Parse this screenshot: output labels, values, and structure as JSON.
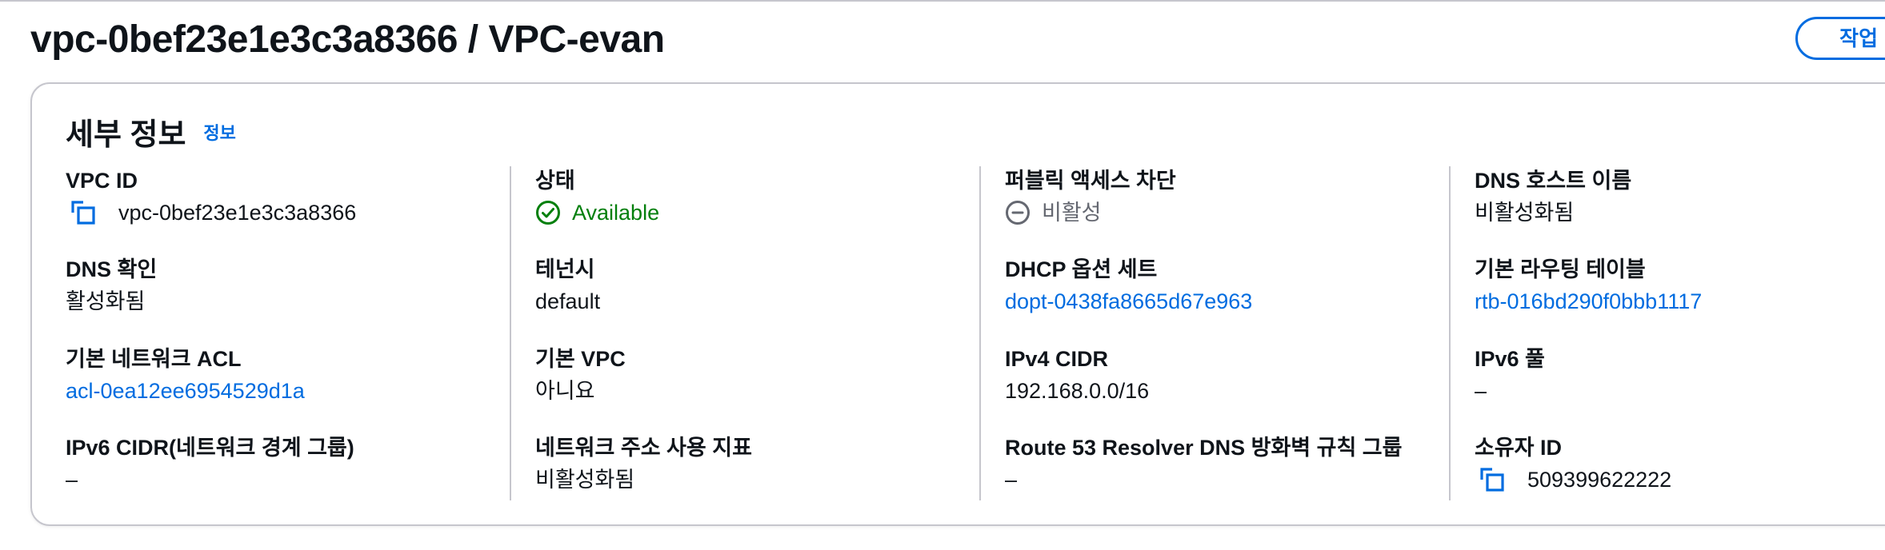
{
  "page": {
    "title": "vpc-0bef23e1e3c3a8366 / VPC-evan",
    "action_button": "작업"
  },
  "panel": {
    "title": "세부 정보",
    "info_link": "정보"
  },
  "columns": [
    [
      {
        "label": "VPC ID",
        "value": "vpc-0bef23e1e3c3a8366"
      },
      {
        "label": "DNS 확인",
        "value": "활성화됨"
      },
      {
        "label": "기본 네트워크 ACL",
        "value": "acl-0ea12ee6954529d1a"
      },
      {
        "label": "IPv6 CIDR(네트워크 경계 그룹)",
        "value": "–"
      }
    ],
    [
      {
        "label": "상태",
        "value": "Available"
      },
      {
        "label": "테넌시",
        "value": "default"
      },
      {
        "label": "기본 VPC",
        "value": "아니요"
      },
      {
        "label": "네트워크 주소 사용 지표",
        "value": "비활성화됨"
      }
    ],
    [
      {
        "label": "퍼블릭 액세스 차단",
        "value": "비활성"
      },
      {
        "label": "DHCP 옵션 세트",
        "value": "dopt-0438fa8665d67e963"
      },
      {
        "label": "IPv4 CIDR",
        "value": "192.168.0.0/16"
      },
      {
        "label": "Route 53 Resolver DNS 방화벽 규칙 그룹",
        "value": "–"
      }
    ],
    [
      {
        "label": "DNS 호스트 이름",
        "value": "비활성화됨"
      },
      {
        "label": "기본 라우팅 테이블",
        "value": "rtb-016bd290f0bbb1117"
      },
      {
        "label": "IPv6 풀",
        "value": "–"
      },
      {
        "label": "소유자 ID",
        "value": "509399622222"
      }
    ]
  ],
  "colors": {
    "link": "#006ce0",
    "success": "#037f0c",
    "muted": "#656871",
    "border": "#c6c6cd",
    "text": "#0f141a"
  },
  "icons": {
    "copy": "copy-icon",
    "status_ok": "check-circle-icon",
    "status_disabled": "minus-circle-icon",
    "dropdown": "caret-down-icon"
  }
}
